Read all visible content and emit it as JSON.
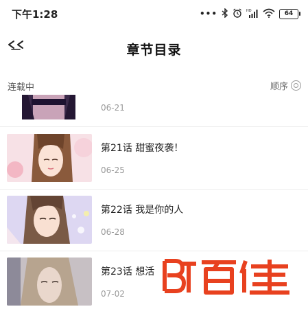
{
  "status_bar": {
    "time": "下午1:28",
    "battery": "64",
    "icons": [
      "dots-icon",
      "bluetooth-icon",
      "alarm-icon",
      "hd-signal-icon",
      "wifi-icon",
      "battery-icon"
    ]
  },
  "header": {
    "back_icon": "back-arrow-icon",
    "title": "章节目录"
  },
  "subheader": {
    "status": "连载中",
    "sort_label": "顺序"
  },
  "chapters": [
    {
      "title": "",
      "date": "06-21"
    },
    {
      "title": "第21话 甜蜜夜袭！",
      "date": "06-25"
    },
    {
      "title": "第22话 我是你的人",
      "date": "06-28"
    },
    {
      "title": "第23话 想活",
      "date": "07-02"
    }
  ],
  "watermark": {
    "text": "BT百佳",
    "color": "#e8411f"
  }
}
